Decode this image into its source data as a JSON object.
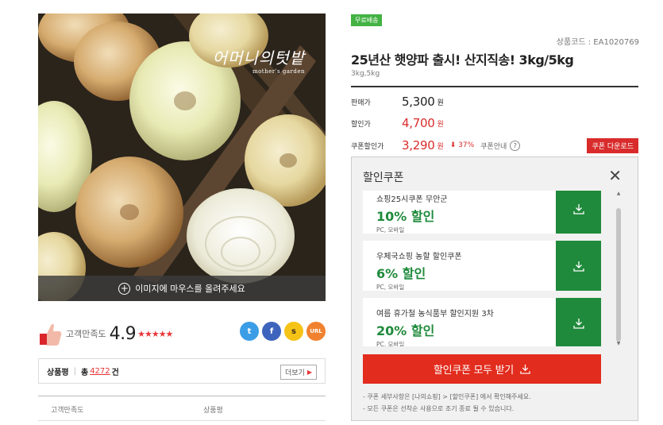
{
  "hero": {
    "brand": "어머니의텃밭",
    "brand_sub": "mother's garden",
    "hover_hint": "이미지에 마우스를 올려주세요"
  },
  "satisfaction": {
    "label": "고객만족도",
    "score": "4.9",
    "stars": "★★★★★",
    "share": {
      "twitter": "t",
      "facebook": "f",
      "kakao": "s",
      "url": "URL"
    }
  },
  "reviews": {
    "label": "상품평",
    "total_prefix": "총",
    "count": "4272",
    "suffix": "건",
    "more": "더보기"
  },
  "table_head": {
    "col1": "고객만족도",
    "col2": "상품평"
  },
  "product": {
    "badge": "무료배송",
    "code": "상품코드 : EA1020769",
    "title": "25년산 햇양파 출시! 산지직송! 3kg/5kg",
    "options": "3kg,5kg"
  },
  "prices": {
    "sale_label": "판매가",
    "sale_value": "5,300",
    "discount_label": "할인가",
    "discount_value": "4,700",
    "coupon_label": "쿠폰할인가",
    "coupon_value": "3,290",
    "won": "원",
    "discount_pct": "⬇ 37%",
    "coupon_guide": "쿠폰안내",
    "coupon_download": "쿠폰 다운로드"
  },
  "coupon_panel": {
    "title": "할인쿠폰",
    "coupons": [
      {
        "name": "쇼핑25시쿠폰 무안군",
        "discount": "10% 할인",
        "platform": "PC, 모바일"
      },
      {
        "name": "우체국쇼핑 농할 할인쿠폰",
        "discount": "6% 할인",
        "platform": "PC, 모바일"
      },
      {
        "name": "여름 휴가철 농식품부 할인지원 3차",
        "discount": "20% 할인",
        "platform": "PC, 모바일"
      }
    ],
    "download_all": "할인쿠폰 모두 받기",
    "note1": "- 쿠폰 세부사항은 [나의쇼핑] > [할인쿠폰] 에서 확인해주세요.",
    "note2": "- 모든 쿠폰은 선착순 사용으로 조기 종료 될 수 있습니다."
  },
  "colors": {
    "accent_red": "#d92b2b",
    "coupon_green": "#1f8a3b",
    "button_red": "#e22c1d",
    "badge_green": "#43b243"
  }
}
